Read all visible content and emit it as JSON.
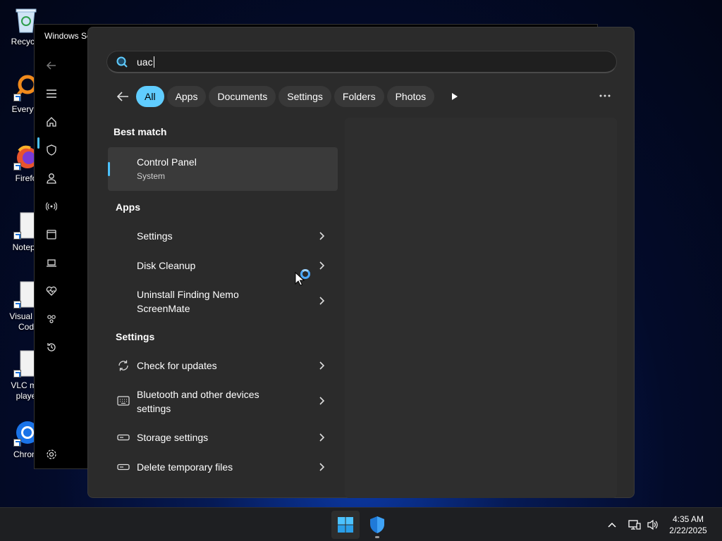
{
  "desktop": {
    "icons": [
      {
        "label": "Recycle",
        "name": "recycle-bin"
      },
      {
        "label": "Everyth",
        "name": "everything"
      },
      {
        "label": "Firefo",
        "name": "firefox"
      },
      {
        "label": "Notepa",
        "name": "notepad"
      },
      {
        "label": "Visual St Cod",
        "name": "visual-studio-code"
      },
      {
        "label": "VLC me playe",
        "name": "vlc"
      },
      {
        "label": "Chrom",
        "name": "chrome"
      }
    ]
  },
  "background_window": {
    "title": "Windows Se",
    "nav_icons": [
      "back-icon",
      "menu-icon",
      "home-icon",
      "shield-icon",
      "person-icon",
      "wifi-icon",
      "app-browser-icon",
      "device-icon",
      "health-icon",
      "family-icon",
      "history-icon",
      "settings-icon"
    ]
  },
  "search": {
    "query": "uac"
  },
  "filters": [
    "All",
    "Apps",
    "Documents",
    "Settings",
    "Folders",
    "Photos"
  ],
  "active_filter": "All",
  "results": {
    "best_match_heading": "Best match",
    "best_match": {
      "title": "Control Panel",
      "subtitle": "System"
    },
    "apps_heading": "Apps",
    "apps": [
      {
        "title": "Settings"
      },
      {
        "title": "Disk Cleanup"
      },
      {
        "title": "Uninstall Finding Nemo ScreenMate"
      }
    ],
    "settings_heading": "Settings",
    "settings": [
      {
        "title": "Check for updates",
        "icon": "refresh-icon"
      },
      {
        "title": "Bluetooth and other devices settings",
        "icon": "keyboard-icon"
      },
      {
        "title": "Storage settings",
        "icon": "storage-icon"
      },
      {
        "title": "Delete temporary files",
        "icon": "storage-icon"
      }
    ]
  },
  "taskbar": {
    "time": "4:35 AM",
    "date": "2/22/2025"
  },
  "colors": {
    "accent": "#60cdff",
    "panel": "#2b2b2b",
    "taskbar": "#1e1f22"
  }
}
